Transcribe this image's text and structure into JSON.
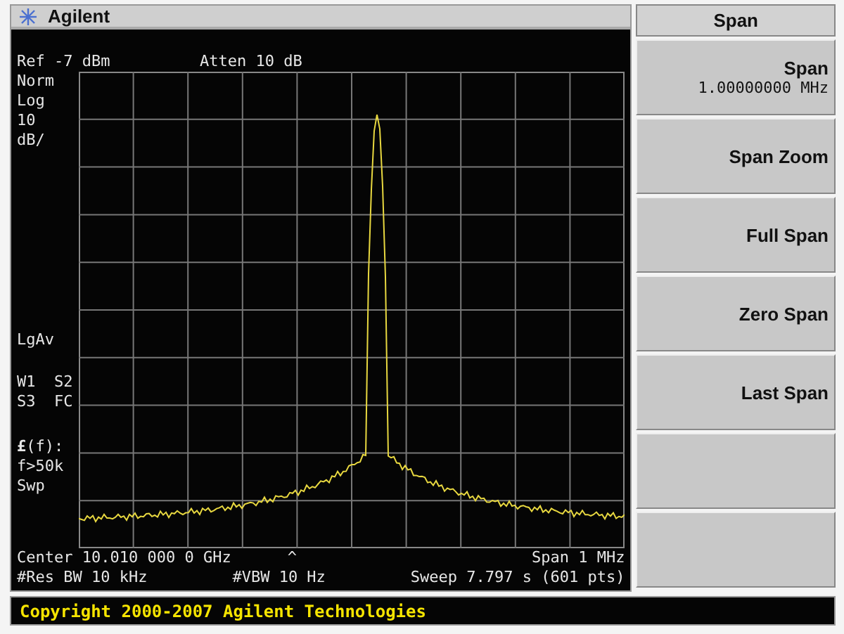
{
  "window": {
    "title": "Agilent"
  },
  "screen": {
    "ref": "Ref -7 dBm",
    "atten": "Atten 10 dB",
    "side_annotations": [
      [
        "Norm",
        "Log",
        "10",
        "dB/"
      ],
      [
        "LgAv"
      ],
      [
        "W1  S2",
        "S3  FC"
      ],
      [
        "**£**(f):",
        "f>50k",
        "Swp"
      ]
    ],
    "footer_row_1": {
      "left": "Center 10.010 000 0 GHz",
      "marker": "^",
      "right": "Span 1 MHz"
    },
    "footer_row_2": {
      "left": "#Res BW 10 kHz",
      "middle": "#VBW 10 Hz",
      "right": "Sweep 7.797 s (601 pts)"
    }
  },
  "softkeys": {
    "title": "Span",
    "keys": [
      {
        "label": "Span",
        "value": "1.00000000 MHz"
      },
      {
        "label": "Span Zoom"
      },
      {
        "label": "Full Span"
      },
      {
        "label": "Zero Span"
      },
      {
        "label": "Last Span"
      },
      {
        "kind": "blank"
      },
      {
        "kind": "blank"
      }
    ]
  },
  "status_bar": {
    "text": "Copyright 2000-2007 Agilent Technologies"
  }
}
